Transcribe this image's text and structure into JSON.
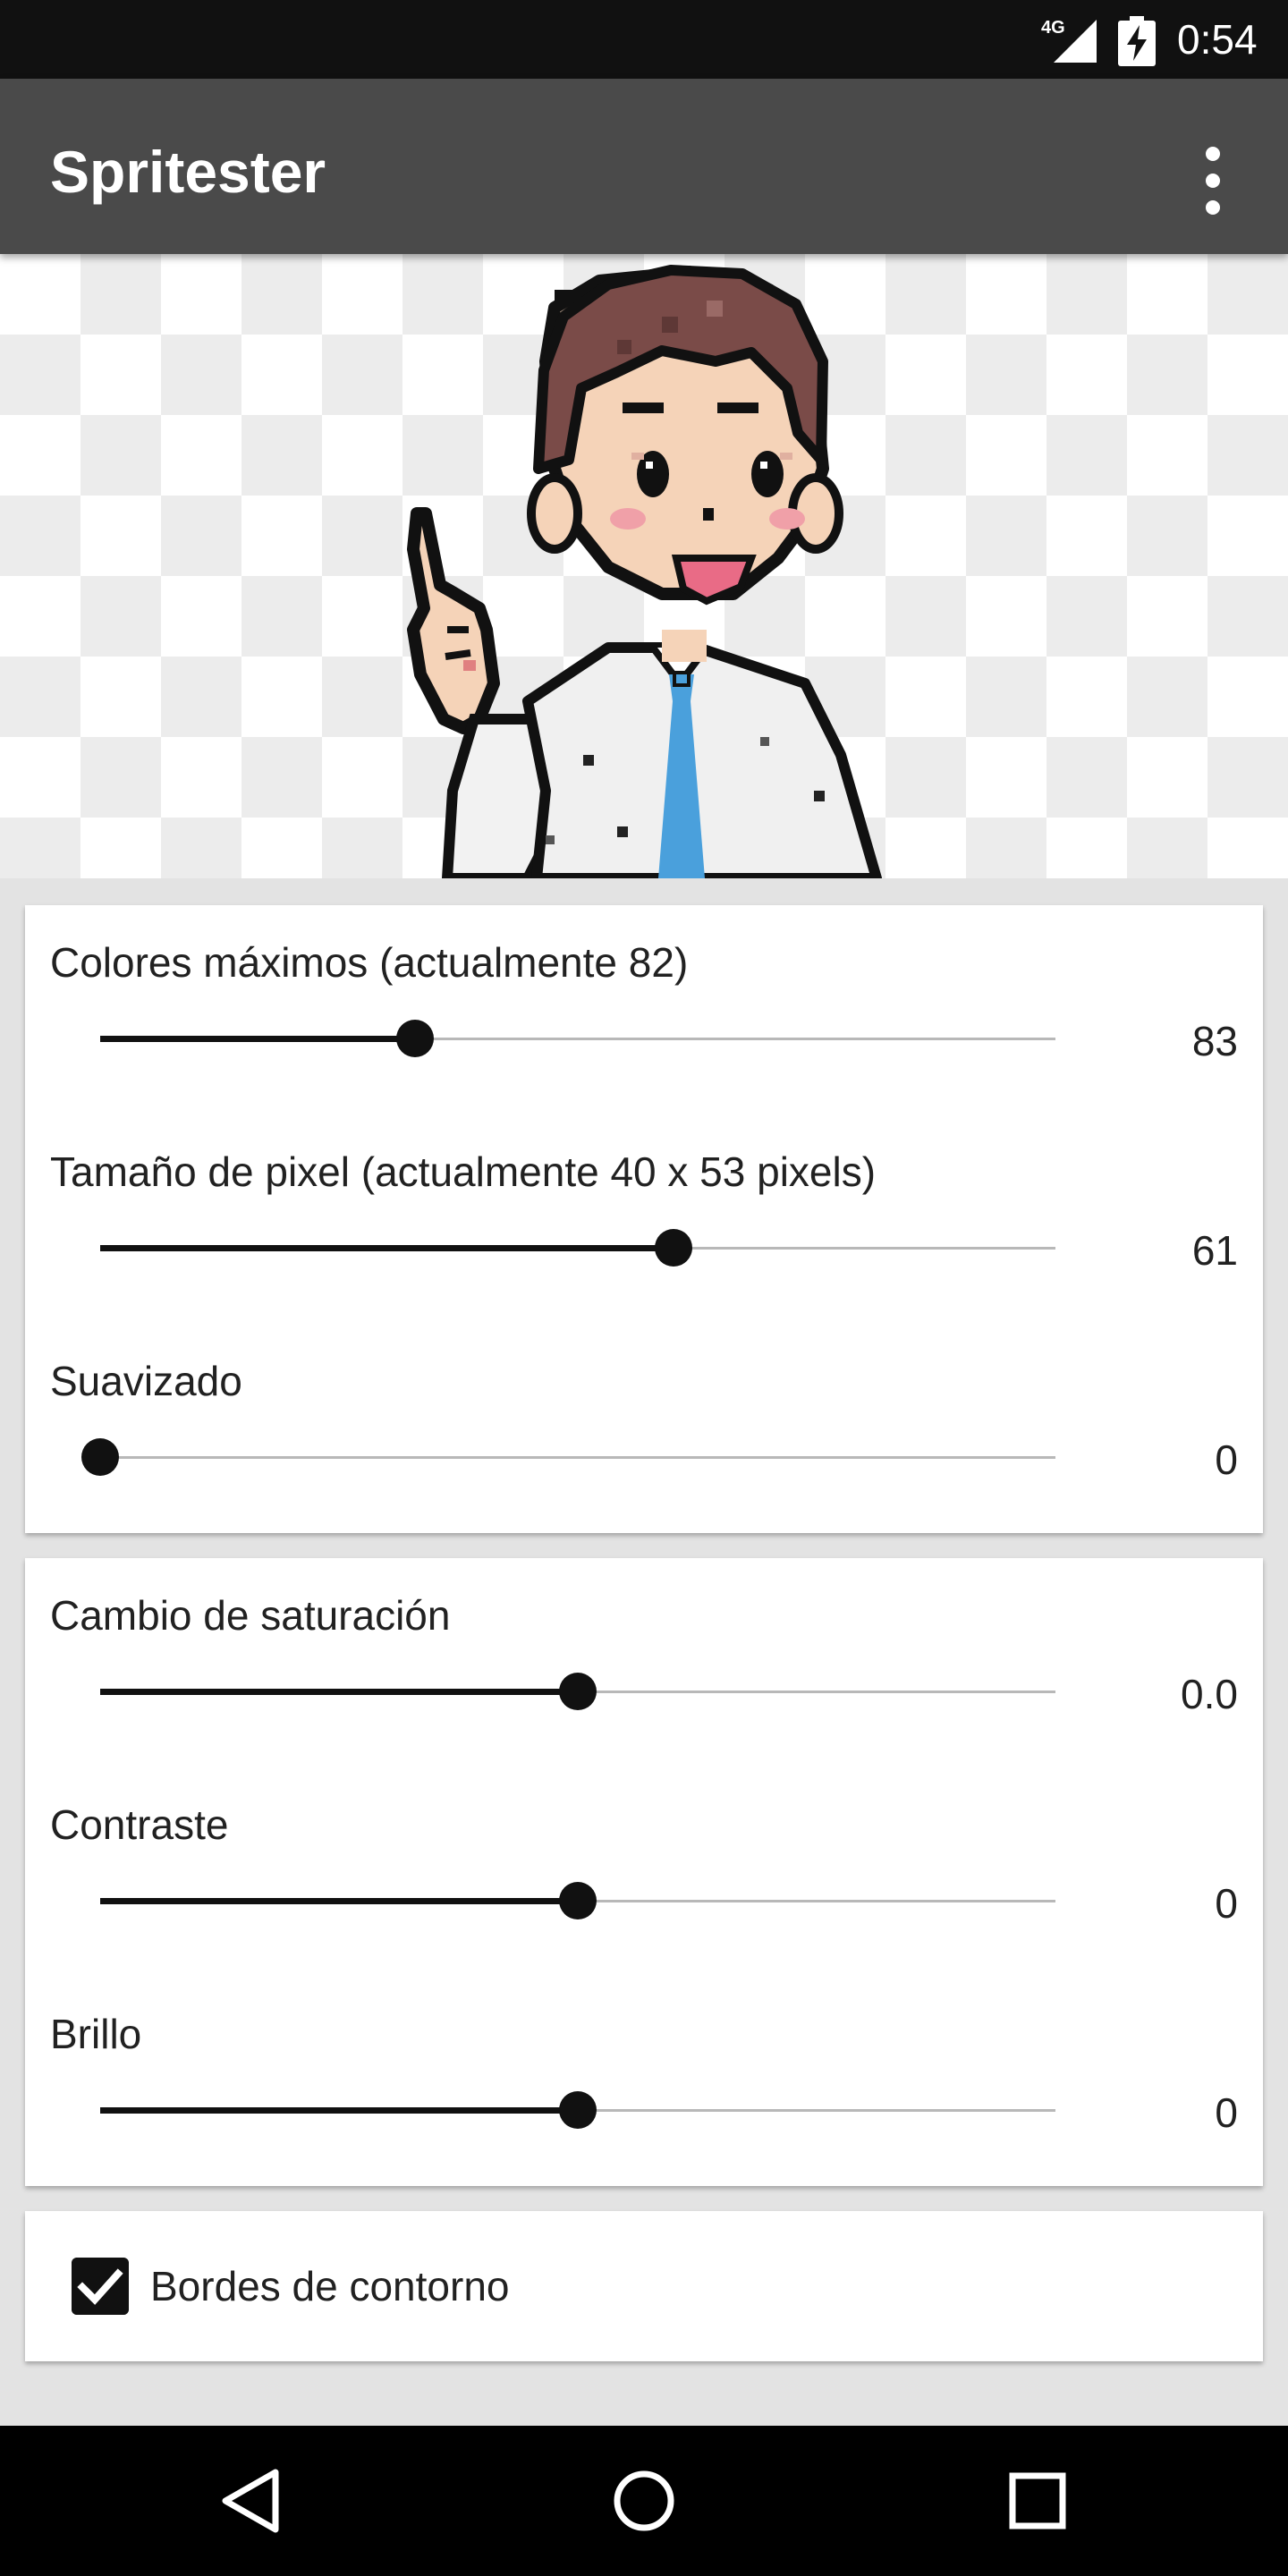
{
  "status_bar": {
    "network": "4G",
    "time": "0:54",
    "icons": [
      "signal-icon",
      "battery-charging-icon"
    ]
  },
  "app_bar": {
    "title": "Spritester",
    "menu_icon": "overflow-menu-icon"
  },
  "preview": {
    "image": "pixel-art sprite of a boy in a white shirt and blue tie pointing up, on a transparency checkerboard"
  },
  "image_settings": [
    {
      "label": "Colores máximos (actualmente 82)",
      "value": "83",
      "position": 0.33
    },
    {
      "label": "Tamaño de pixel (actualmente 40 x 53 pixels)",
      "value": "61",
      "position": 0.6
    },
    {
      "label": "Suavizado",
      "value": "0",
      "position": 0.0
    }
  ],
  "color_settings": [
    {
      "label": "Cambio de saturación",
      "value": "0.0",
      "position": 0.5
    },
    {
      "label": "Contraste",
      "value": "0",
      "position": 0.5
    },
    {
      "label": "Brillo",
      "value": "0",
      "position": 0.5
    }
  ],
  "outline": {
    "label": "Bordes de contorno",
    "checked": true
  },
  "nav_bar": {
    "buttons": [
      "back-icon",
      "home-icon",
      "recents-icon"
    ]
  },
  "colors": {
    "app_bar": "#4a4a4a",
    "status_bar": "#111111",
    "accent": "#111111",
    "background": "#e3e3e3"
  }
}
